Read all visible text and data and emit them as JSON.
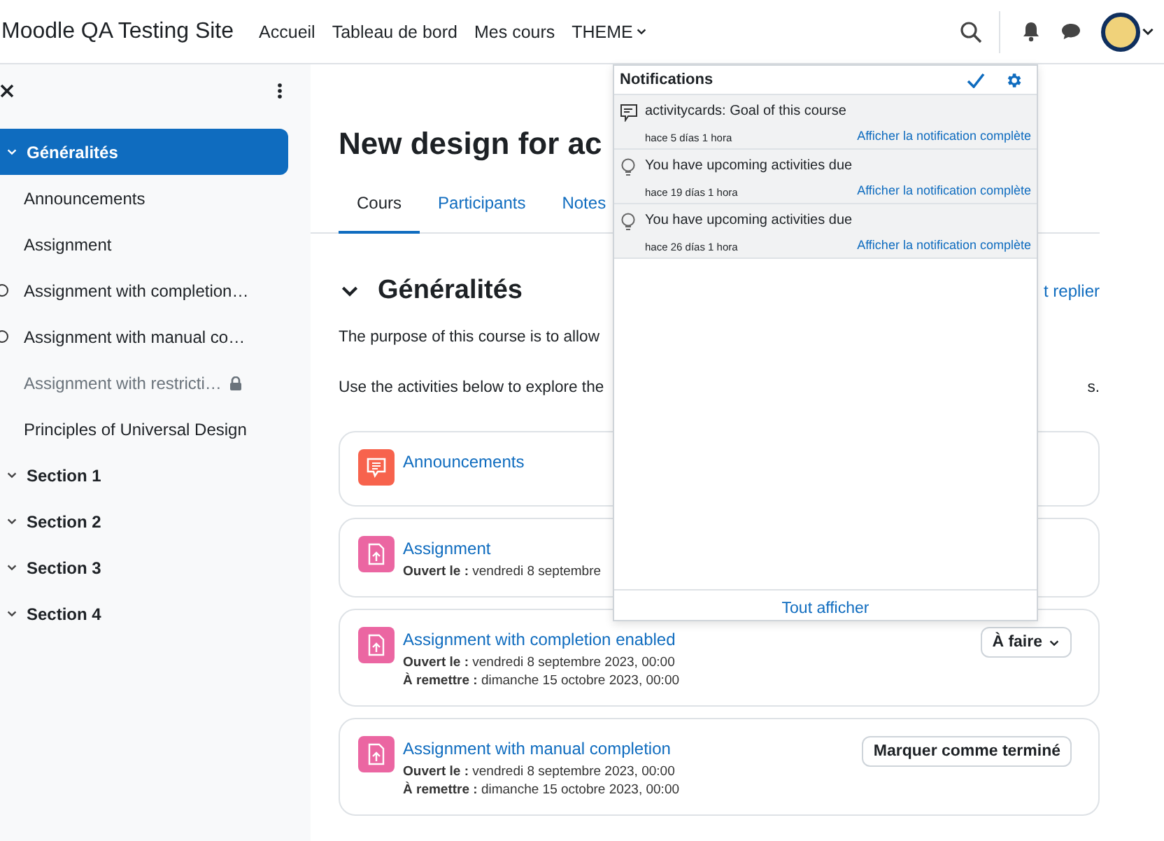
{
  "navbar": {
    "site_name": "Moodle QA Testing Site",
    "links": [
      {
        "label": "Accueil",
        "dropdown": false
      },
      {
        "label": "Tableau de bord",
        "dropdown": false
      },
      {
        "label": "Mes cours",
        "dropdown": false
      },
      {
        "label": "THEME",
        "dropdown": true
      }
    ]
  },
  "sidebar": {
    "items": [
      {
        "label": "Généralités",
        "selected": true,
        "children": [
          {
            "label": "Announcements",
            "completion": false,
            "restricted": false
          },
          {
            "label": "Assignment",
            "completion": false,
            "restricted": false
          },
          {
            "label": "Assignment with completion…",
            "completion": true,
            "restricted": false
          },
          {
            "label": "Assignment with manual co…",
            "completion": true,
            "restricted": false
          },
          {
            "label": "Assignment with restricti…",
            "completion": false,
            "restricted": true
          },
          {
            "label": "Principles of Universal Design",
            "completion": false,
            "restricted": false
          }
        ]
      },
      {
        "label": "Section 1",
        "selected": false
      },
      {
        "label": "Section 2",
        "selected": false
      },
      {
        "label": "Section 3",
        "selected": false
      },
      {
        "label": "Section 4",
        "selected": false
      }
    ]
  },
  "course": {
    "title": "New design for ac",
    "tabs": [
      {
        "label": "Cours",
        "selected": true
      },
      {
        "label": "Participants",
        "selected": false
      },
      {
        "label": "Notes",
        "selected": false
      }
    ],
    "section": {
      "title": "Généralités",
      "collapse_link": "t replier",
      "paragraphs": [
        {
          "left": "The purpose of this course is to allow"
        },
        {
          "left": "Use the activities below to explore the",
          "right": "s."
        }
      ],
      "activities": [
        {
          "title": "Announcements",
          "kind": "forum"
        },
        {
          "title": "Assignment",
          "kind": "assign",
          "dates": [
            {
              "label": "Ouvert le :",
              "value": "vendredi 8 septembre"
            }
          ]
        },
        {
          "title": "Assignment with completion enabled",
          "kind": "assign",
          "dates": [
            {
              "label": "Ouvert le :",
              "value": "vendredi 8 septembre 2023, 00:00"
            },
            {
              "label": "À remettre :",
              "value": "dimanche 15 octobre 2023, 00:00"
            }
          ],
          "action": {
            "kind": "dropdown",
            "label": "À faire"
          }
        },
        {
          "title": "Assignment with manual completion",
          "kind": "assign",
          "dates": [
            {
              "label": "Ouvert le :",
              "value": "vendredi 8 septembre 2023, 00:00"
            },
            {
              "label": "À remettre :",
              "value": "dimanche 15 octobre 2023, 00:00"
            }
          ],
          "action": {
            "kind": "button",
            "label": "Marquer comme terminé"
          }
        }
      ]
    }
  },
  "notifications": {
    "title": "Notifications",
    "items": [
      {
        "kind": "message",
        "title": "activitycards: Goal of this course",
        "time": "hace 5 días 1 hora",
        "link": "Afficher la notification complète",
        "unread": true
      },
      {
        "kind": "reminder",
        "title": "You have upcoming activities due",
        "time": "hace 19 días 1 hora",
        "link": "Afficher la notification complète",
        "unread": true
      },
      {
        "kind": "reminder",
        "title": "You have upcoming activities due",
        "time": "hace 26 días 1 hora",
        "link": "Afficher la notification complète",
        "unread": true
      }
    ],
    "footer": "Tout afficher"
  }
}
